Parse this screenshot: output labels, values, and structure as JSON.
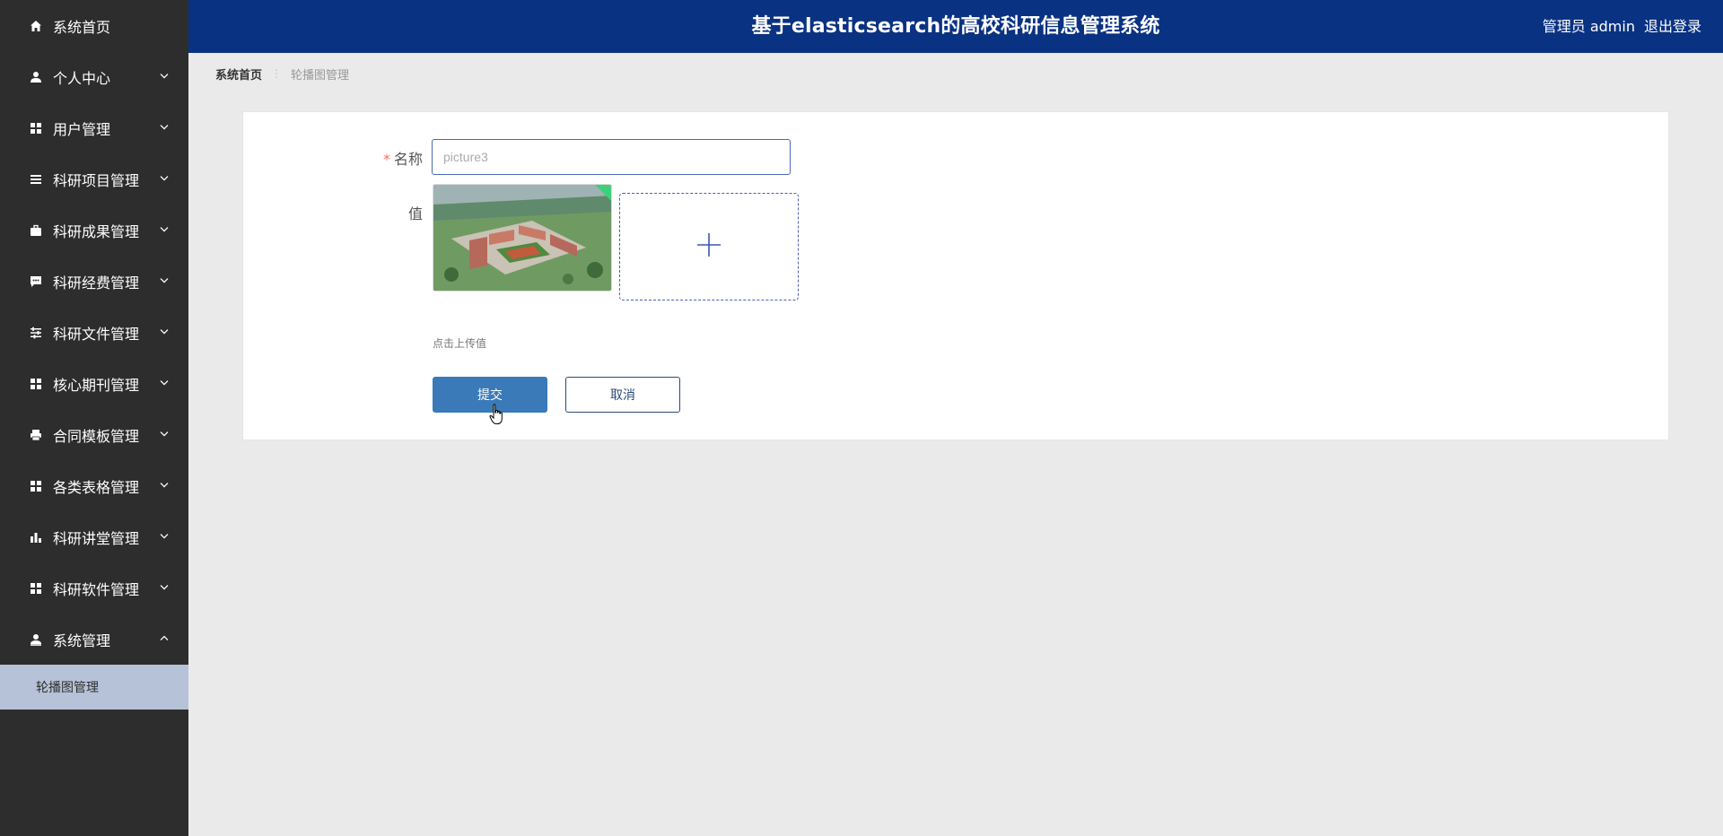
{
  "header": {
    "title": "基于elasticsearch的高校科研信息管理系统",
    "user_label": "管理员 admin",
    "logout_label": "退出登录"
  },
  "sidebar": {
    "items": [
      {
        "label": "系统首页",
        "icon": "home-icon",
        "has_chevron": false
      },
      {
        "label": "个人中心",
        "icon": "user-icon",
        "has_chevron": true
      },
      {
        "label": "用户管理",
        "icon": "grid-icon",
        "has_chevron": true
      },
      {
        "label": "科研项目管理",
        "icon": "list-icon",
        "has_chevron": true
      },
      {
        "label": "科研成果管理",
        "icon": "briefcase-icon",
        "has_chevron": true
      },
      {
        "label": "科研经费管理",
        "icon": "chat-icon",
        "has_chevron": true
      },
      {
        "label": "科研文件管理",
        "icon": "sliders-icon",
        "has_chevron": true
      },
      {
        "label": "核心期刊管理",
        "icon": "grid-icon",
        "has_chevron": true
      },
      {
        "label": "合同模板管理",
        "icon": "printer-icon",
        "has_chevron": true
      },
      {
        "label": "各类表格管理",
        "icon": "grid-icon",
        "has_chevron": true
      },
      {
        "label": "科研讲堂管理",
        "icon": "bar-chart-icon",
        "has_chevron": true
      },
      {
        "label": "科研软件管理",
        "icon": "grid-icon",
        "has_chevron": true
      },
      {
        "label": "系统管理",
        "icon": "admin-user-icon",
        "has_chevron": true,
        "expanded": true
      }
    ],
    "submenu": [
      {
        "label": "轮播图管理",
        "active": true
      }
    ]
  },
  "breadcrumb": {
    "home": "系统首页",
    "current": "轮播图管理"
  },
  "form": {
    "name_label": "名称",
    "name_placeholder": "picture3",
    "value_label": "值",
    "upload_hint": "点击上传值",
    "submit_label": "提交",
    "cancel_label": "取消"
  },
  "colors": {
    "header_bg": "#0a3282",
    "sidebar_bg": "#2d2d2d",
    "submenu_active_bg": "#b6c2d8",
    "primary_button": "#3a7ab8",
    "required_star": "#f56c6c"
  }
}
